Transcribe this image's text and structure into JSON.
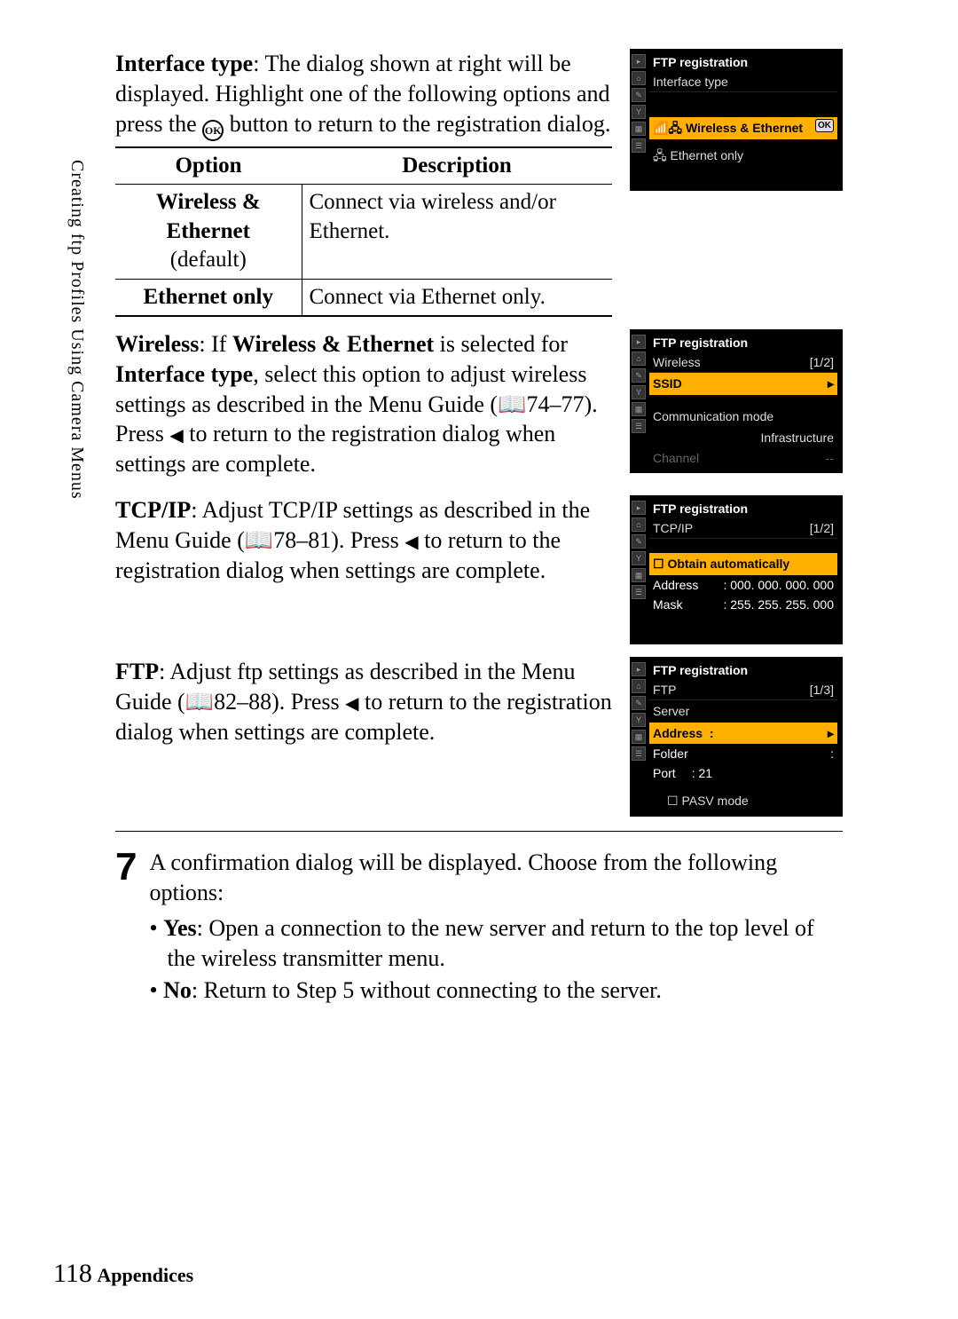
{
  "side_label": "Creating ftp Profiles Using Camera Menus",
  "section1": {
    "lead_bold": "Interface type",
    "lead_rest": ": The dialog shown at right will be displayed. Highlight one of the following options and press the ",
    "lead_after": " button to return to the registration dialog."
  },
  "table": {
    "h1": "Option",
    "h2": "Description",
    "r1c1_b": "Wireless & Ethernet",
    "r1c1_s": "(default)",
    "r1c2": "Connect via wireless and/or Ethernet.",
    "r2c1": "Ethernet only",
    "r2c2": "Connect via Ethernet only."
  },
  "wireless": {
    "lead": "Wireless",
    "mid1": ": If ",
    "bold1": "Wireless & Ethernet",
    "mid2": " is selected for ",
    "bold2": "Interface type",
    "rest": ", select this option to adjust wireless settings as described in the Menu Guide (📖74–77).  Press ",
    "rest2": " to return to the registration dialog when settings are complete."
  },
  "tcpip": {
    "lead": "TCP/IP",
    "rest": ": Adjust TCP/IP settings as described in the Menu Guide (📖78–81).  Press ",
    "rest2": " to return to the registration dialog when settings are complete."
  },
  "ftp": {
    "lead": "FTP",
    "rest": ": Adjust ftp settings as described in the Menu Guide (📖82–88).  Press ",
    "rest2": " to return to the registration dialog when settings are complete."
  },
  "lcd1": {
    "title": "FTP registration",
    "sub": "Interface type",
    "sel": "Wireless & Ethernet",
    "item": "Ethernet only"
  },
  "lcd2": {
    "title": "FTP registration",
    "sub": "Wireless",
    "pg": "[1/2]",
    "ssid": "SSID",
    "comm": "Communication mode",
    "comm_v": "Infrastructure",
    "chan": "Channel",
    "chan_v": "--"
  },
  "lcd3": {
    "title": "FTP registration",
    "sub": "TCP/IP",
    "pg": "[1/2]",
    "auto": "Obtain automatically",
    "addr_l": "Address",
    "addr_v": ": 000. 000. 000. 000",
    "mask_l": "Mask",
    "mask_v": ": 255. 255. 255. 000"
  },
  "lcd4": {
    "title": "FTP registration",
    "sub": "FTP",
    "pg": "[1/3]",
    "server": "Server",
    "addr": "Address",
    "addr_v": ":",
    "folder": "Folder",
    "folder_v": ":",
    "port": "Port",
    "port_v": ": 21",
    "pasv": "PASV mode"
  },
  "step7": {
    "num": "7",
    "intro": "A confirmation dialog will be displayed.  Choose from the following options:",
    "yes_b": "Yes",
    "yes": ": Open a connection to the new server and return to the top level of the wireless transmitter menu.",
    "no_b": "No",
    "no": ": Return to Step 5 without connecting to the server."
  },
  "footer": {
    "page": "118",
    "section": "Appendices"
  }
}
